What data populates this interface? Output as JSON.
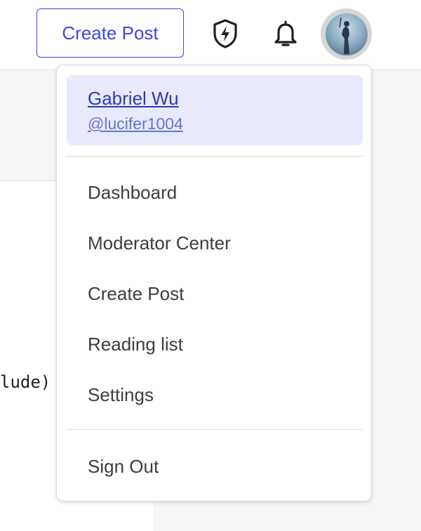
{
  "header": {
    "create_post_label": "Create Post",
    "icons": [
      "shield-bolt-icon",
      "bell-icon",
      "avatar"
    ]
  },
  "background": {
    "code_fragment": "lude)"
  },
  "user_menu": {
    "profile": {
      "name": "Gabriel Wu",
      "handle": "@lucifer1004"
    },
    "items": [
      {
        "label": "Dashboard"
      },
      {
        "label": "Moderator Center"
      },
      {
        "label": "Create Post"
      },
      {
        "label": "Reading list"
      },
      {
        "label": "Settings"
      }
    ],
    "sign_out_label": "Sign Out"
  },
  "colors": {
    "accent": "#3b49df",
    "profile_highlight": "#e8eafc",
    "menu_text": "#3d3d3d"
  }
}
